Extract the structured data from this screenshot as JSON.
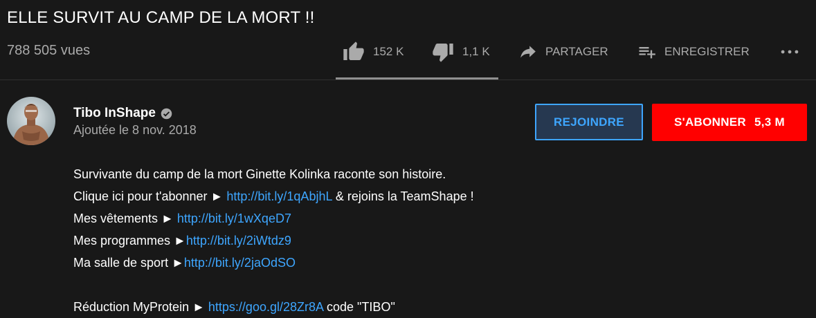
{
  "video": {
    "title": "ELLE SURVIT AU CAMP DE LA MORT !!",
    "views": "788 505 vues"
  },
  "actions": {
    "like_count": "152 K",
    "dislike_count": "1,1 K",
    "share_label": "PARTAGER",
    "save_label": "ENREGISTRER",
    "like_ratio": 0.993
  },
  "channel": {
    "name": "Tibo InShape",
    "date": "Ajoutée le 8 nov. 2018",
    "join_label": "REJOINDRE",
    "subscribe_label": "S'ABONNER",
    "subscriber_count": "5,3 M"
  },
  "description": {
    "line1": "Survivante du camp de la mort Ginette Kolinka raconte son histoire.",
    "line2_prefix": "Clique ici pour t'abonner ► ",
    "line2_link": "http://bit.ly/1qAbjhL",
    "line2_suffix": " & rejoins la TeamShape !",
    "line3_prefix": "Mes vêtements ► ",
    "line3_link": "http://bit.ly/1wXqeD7",
    "line4_prefix": "Mes programmes ►",
    "line4_link": "http://bit.ly/2iWtdz9",
    "line5_prefix": "Ma salle de sport ►",
    "line5_link": "http://bit.ly/2jaOdSO",
    "line6_prefix": "Réduction MyProtein ► ",
    "line6_link": "https://goo.gl/28Zr8A",
    "line6_suffix": " code \"TIBO\""
  },
  "colors": {
    "background": "#181818",
    "link": "#3ea6ff",
    "subscribe": "#ff0000",
    "secondary_text": "#aaaaaa"
  }
}
